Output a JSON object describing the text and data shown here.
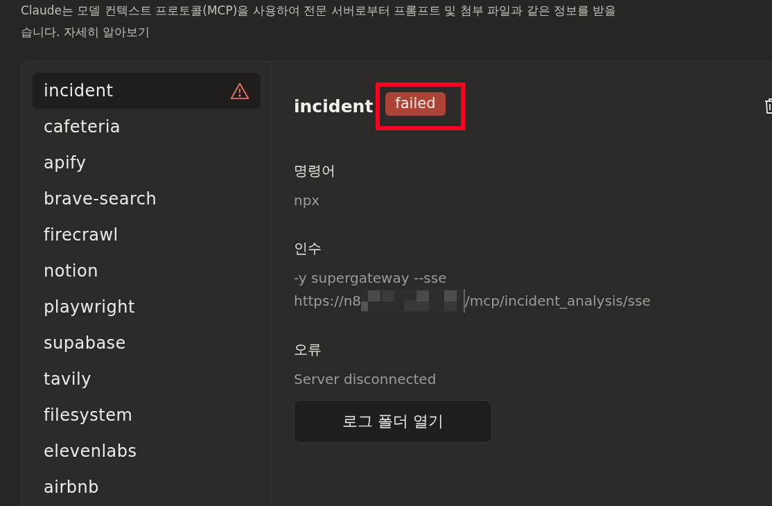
{
  "intro": {
    "text": "Claude는 모델 컨텍스트 프로토콜(MCP)을 사용하여 전문 서버로부터 프롬프트 및 첨부 파일과 같은 정보를 받을",
    "text_end": "습니다.",
    "link": "자세히 알아보기"
  },
  "servers": [
    {
      "name": "incident",
      "selected": true,
      "warning": true
    },
    {
      "name": "cafeteria",
      "selected": false,
      "warning": false
    },
    {
      "name": "apify",
      "selected": false,
      "warning": false
    },
    {
      "name": "brave-search",
      "selected": false,
      "warning": false
    },
    {
      "name": "firecrawl",
      "selected": false,
      "warning": false
    },
    {
      "name": "notion",
      "selected": false,
      "warning": false
    },
    {
      "name": "playwright",
      "selected": false,
      "warning": false
    },
    {
      "name": "supabase",
      "selected": false,
      "warning": false
    },
    {
      "name": "tavily",
      "selected": false,
      "warning": false
    },
    {
      "name": "filesystem",
      "selected": false,
      "warning": false
    },
    {
      "name": "elevenlabs",
      "selected": false,
      "warning": false
    },
    {
      "name": "airbnb",
      "selected": false,
      "warning": false
    }
  ],
  "detail": {
    "name": "incident",
    "status": "failed",
    "highlighted": true,
    "command_label": "명령어",
    "command": "npx",
    "args_label": "인수",
    "args": "-y supergateway --sse",
    "url_start": "https://n8",
    "url_end": "/mcp/incident_analysis/sse",
    "error_label": "오류",
    "error": "Server disconnected",
    "button": "로그 폴더 열기"
  }
}
